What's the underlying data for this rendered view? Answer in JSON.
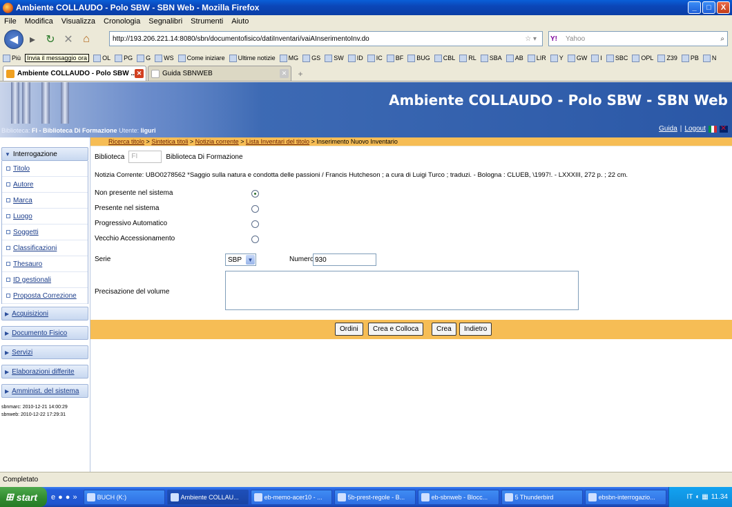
{
  "window": {
    "title": "Ambiente COLLAUDO - Polo SBW - SBN Web - Mozilla Firefox",
    "controls": [
      "_",
      "□",
      "X"
    ]
  },
  "menu": [
    "File",
    "Modifica",
    "Visualizza",
    "Cronologia",
    "Segnalibri",
    "Strumenti",
    "Aiuto"
  ],
  "nav": {
    "url": "http://193.206.221.14:8080/sbn/documentofisico/datiInventari/vaiAInserimentoInv.do",
    "search_placeholder": "Yahoo",
    "search_engine": "Y!"
  },
  "bookmarks": {
    "first": "Più",
    "tooltip": "Invia il messaggio ora",
    "items": [
      "OL",
      "PG",
      "G",
      "WS",
      "Come iniziare",
      "Ultime notizie",
      "MG",
      "GS",
      "SW",
      "ID",
      "IC",
      "BF",
      "BUG",
      "CBL",
      "RL",
      "SBA",
      "AB",
      "LIR",
      "Y",
      "GW",
      "I",
      "SBC",
      "OPL",
      "Z39",
      "PB",
      "N"
    ]
  },
  "tabs": [
    {
      "label": "Ambiente COLLAUDO - Polo SBW ...",
      "active": true
    },
    {
      "label": "Guida SBNWEB",
      "active": false
    }
  ],
  "header": {
    "title": "Ambiente COLLAUDO - Polo SBW - SBN Web",
    "biblioteca_label": "Biblioteca:",
    "biblioteca_value": "FI - Biblioteca Di Formazione",
    "utente_label": "Utente:",
    "utente_value": "liguri",
    "guida": "Guida",
    "separator": "|",
    "logout": "Logout"
  },
  "breadcrumb": {
    "links": [
      "Ricerca titolo",
      "Sintetica titoli",
      "Notizia corrente",
      "Lista Inventari del titolo"
    ],
    "separator": ">",
    "current": "Inserimento Nuovo Inventario"
  },
  "sidebar": {
    "section_open": "Interrogazione",
    "items": [
      "Titolo",
      "Autore",
      "Marca",
      "Luogo",
      "Soggetti",
      "Classificazioni",
      "Thesauro",
      "ID gestionali",
      "Proposta Correzione"
    ],
    "sections": [
      "Acquisizioni",
      "Documento Fisico",
      "Servizi",
      "Elaborazioni differite",
      "Amminist. del sistema"
    ],
    "meta": [
      "sbnmarc:  2010-12-21 14:00:29",
      "sbnweb:  2010-12-22 17:29:31"
    ]
  },
  "form": {
    "biblioteca_label": "Biblioteca",
    "biblioteca_code": "FI",
    "biblioteca_name": "Biblioteca Di Formazione",
    "notizia": "Notizia Corrente: UBO0278562 *Saggio sulla natura e condotta delle passioni / Francis Hutcheson ; a cura di Luigi Turco ; traduzi. - Bologna : CLUEB, \\1997!. - LXXXIII, 272 p. ; 22 cm.",
    "options": [
      {
        "label": "Non presente nel sistema",
        "checked": true
      },
      {
        "label": "Presente nel sistema",
        "checked": false
      },
      {
        "label": "Progressivo Automatico",
        "checked": false
      },
      {
        "label": "Vecchio Accessionamento",
        "checked": false
      }
    ],
    "serie_label": "Serie",
    "serie_value": "SBP",
    "numero_label": "Numero",
    "numero_value": "930",
    "precisazione_label": "Precisazione del volume",
    "precisazione_value": ""
  },
  "buttons": [
    "Ordini",
    "Crea e Colloca",
    "Crea",
    "Indietro"
  ],
  "status": "Completato",
  "taskbar": {
    "start": "start",
    "items": [
      {
        "label": "BUCH (K:)",
        "active": false
      },
      {
        "label": "Ambiente COLLAU...",
        "active": true
      },
      {
        "label": "eb-memo-acer10 - ...",
        "active": false
      },
      {
        "label": "5b-prest-regole - B...",
        "active": false
      },
      {
        "label": "eb-sbnweb - Blocc...",
        "active": false
      },
      {
        "label": "5 Thunderbird",
        "active": false
      },
      {
        "label": "ebsbn-interrogazio...",
        "active": false
      }
    ],
    "lang": "IT",
    "clock": "11.34"
  }
}
